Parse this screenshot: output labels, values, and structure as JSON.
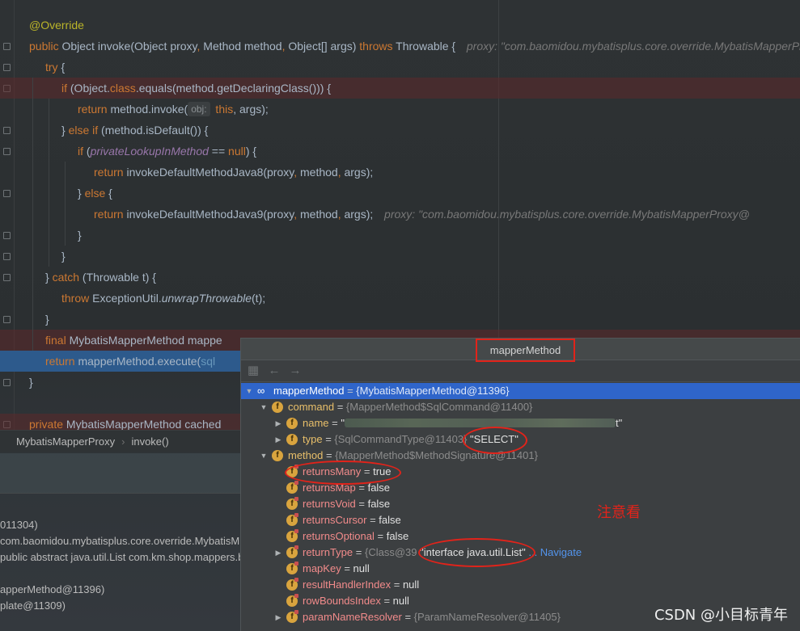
{
  "editor": {
    "lines": [
      {
        "t": "annotation",
        "text": "@Override"
      },
      {
        "t": "sig",
        "kw1": "public",
        "p1": " Object ",
        "name": "invoke",
        "p2": "(Object proxy",
        "c1": ",",
        "p3": " Method method",
        "c2": ",",
        "p4": " Object[] args) ",
        "kw2": "throws",
        "p5": " Throwable {",
        "hint": "proxy: \"com.baomidou.mybatisplus.core.override.MybatisMapperProxy@"
      },
      {
        "t": "simple",
        "kw": "try",
        "rest": " {"
      },
      {
        "t": "if1",
        "kw": "if",
        "a": " (Object.",
        "kw2": "class",
        "b": ".equals(method.getDeclaringClass())) {"
      },
      {
        "t": "ret1",
        "kw": "return",
        "a": " method.invoke(",
        "phint": "obj:",
        "kw2": " this",
        "b": ", args);"
      },
      {
        "t": "elseif",
        "a": "} ",
        "kw": "else if",
        "b": " (method.isDefault()) {"
      },
      {
        "t": "if2",
        "kw": "if",
        "a": " (",
        "fld": "privateLookupInMethod",
        "b": " == ",
        "kw2": "null",
        "c": ") {"
      },
      {
        "t": "ret2",
        "kw": "return",
        "a": " invokeDefaultMethodJava8(proxy",
        "c1": ",",
        "b": " method",
        "c2": ",",
        "c": " args);"
      },
      {
        "t": "else",
        "a": "} ",
        "kw": "else",
        "b": " {"
      },
      {
        "t": "ret3",
        "kw": "return",
        "a": " invokeDefaultMethodJava9(proxy",
        "c1": ",",
        "b": " method",
        "c2": ",",
        "c": " args);",
        "hint": "proxy: \"com.baomidou.mybatisplus.core.override.MybatisMapperProxy@"
      },
      {
        "t": "brace",
        "text": "}"
      },
      {
        "t": "brace",
        "text": "}"
      },
      {
        "t": "catch",
        "a": "} ",
        "kw": "catch",
        "b": " (Throwable t) {"
      },
      {
        "t": "throw",
        "kw": "throw",
        "a": " ExceptionUtil.",
        "sta": "unwrapThrowable",
        "b": "(t);"
      },
      {
        "t": "brace",
        "text": "}"
      },
      {
        "t": "final",
        "kw": "final",
        "a": " MybatisMapperMethod mappe"
      },
      {
        "t": "return",
        "kw": "return",
        "a": " mapperMethod.execute(",
        "b": "sql"
      },
      {
        "t": "brace",
        "text": "}"
      },
      {
        "t": "blank",
        "text": ""
      },
      {
        "t": "private",
        "kw": "private",
        "a": " MybatisMapperMethod cached"
      }
    ]
  },
  "breadcrumb": {
    "class_name": "MybatisMapperProxy",
    "method_name": "invoke()"
  },
  "frames": [
    "011304)",
    "com.baomidou.mybatisplus.core.override.MybatisM",
    "public abstract java.util.List com.km.shop.mappers.b",
    "",
    "apperMethod@11396)",
    "plate@11309)"
  ],
  "popup": {
    "title": "mapperMethod",
    "tree": [
      {
        "depth": 0,
        "arrow": "down",
        "icon": "oo",
        "name": "mapperMethod",
        "eq": " = ",
        "type": "{MybatisMapperMethod@11396}",
        "selected": true
      },
      {
        "depth": 1,
        "arrow": "down",
        "icon": "f",
        "name": "command",
        "eq": " = ",
        "type": "{MapperMethod$SqlCommand@11400}"
      },
      {
        "depth": 2,
        "arrow": "right",
        "icon": "f",
        "name": "name",
        "eq": " = ",
        "value": "\"",
        "blur": true,
        "value2": "t\""
      },
      {
        "depth": 2,
        "arrow": "right",
        "icon": "f",
        "name": "type",
        "eq": " = ",
        "type": "{SqlCommandType@11403}",
        "value": " \"SELECT\""
      },
      {
        "depth": 1,
        "arrow": "down",
        "icon": "f",
        "name": "method",
        "eq": " = ",
        "type": "{MapperMethod$MethodSignature@11401}"
      },
      {
        "depth": 2,
        "icon": "f",
        "lock": true,
        "name": "returnsMany",
        "eq": " = ",
        "value": "true",
        "red": true
      },
      {
        "depth": 2,
        "icon": "f",
        "lock": true,
        "name": "returnsMap",
        "eq": " = ",
        "value": "false",
        "red": true
      },
      {
        "depth": 2,
        "icon": "f",
        "lock": true,
        "name": "returnsVoid",
        "eq": " = ",
        "value": "false",
        "red": true
      },
      {
        "depth": 2,
        "icon": "f",
        "lock": true,
        "name": "returnsCursor",
        "eq": " = ",
        "value": "false",
        "red": true
      },
      {
        "depth": 2,
        "icon": "f",
        "lock": true,
        "name": "returnsOptional",
        "eq": " = ",
        "value": "false",
        "red": true
      },
      {
        "depth": 2,
        "arrow": "right",
        "icon": "f",
        "lock": true,
        "name": "returnType",
        "eq": " = ",
        "type": "{Class@39",
        "value": " \"interface java.util.List\"",
        "link": "... Navigate",
        "red": true
      },
      {
        "depth": 2,
        "icon": "f",
        "lock": true,
        "name": "mapKey",
        "eq": " = ",
        "value": "null",
        "red": true
      },
      {
        "depth": 2,
        "icon": "f",
        "lock": true,
        "name": "resultHandlerIndex",
        "eq": " = ",
        "value": "null",
        "red": true
      },
      {
        "depth": 2,
        "icon": "f",
        "lock": true,
        "name": "rowBoundsIndex",
        "eq": " = ",
        "value": "null",
        "red": true
      },
      {
        "depth": 2,
        "arrow": "right",
        "icon": "f",
        "lock": true,
        "name": "paramNameResolver",
        "eq": " = ",
        "type": "{ParamNameResolver@11405}",
        "red": true
      }
    ],
    "note": "注意看"
  },
  "watermark": "CSDN @小目标青年",
  "colors": {
    "keyword": "#cc7832",
    "annotation": "#bbb529",
    "field": "#9876aa",
    "selection": "#2f65ca",
    "highlight_red": "#5c282a",
    "highlight_blue": "#2d5a8c",
    "marker": "#e2231a"
  }
}
